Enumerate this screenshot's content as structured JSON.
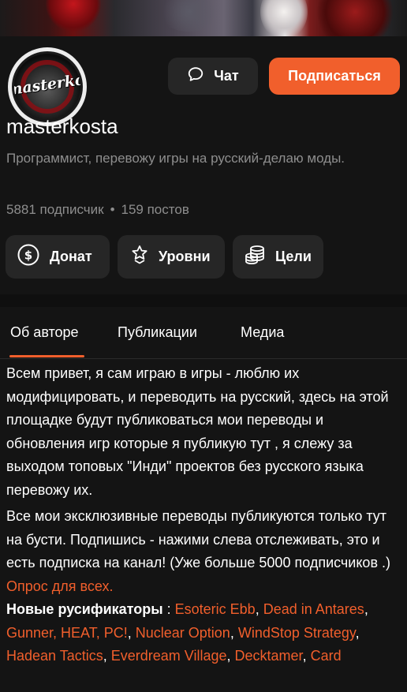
{
  "profile": {
    "avatar_logo_text": "masterkosta",
    "username": "masterkosta",
    "bio": "Программист, перевожу игры на русский-делаю моды.",
    "subscribers": "5881 подписчик",
    "separator": "•",
    "posts": "159 постов"
  },
  "header_buttons": {
    "chat_label": "Чат",
    "subscribe_label": "Подписаться"
  },
  "actions": {
    "donate_label": "Донат",
    "levels_label": "Уровни",
    "goals_label": "Цели"
  },
  "tabs": [
    {
      "label": "Об авторе",
      "active": true
    },
    {
      "label": "Публикации",
      "active": false
    },
    {
      "label": "Медиа",
      "active": false
    }
  ],
  "about": {
    "paragraph1": "Всем привет, я сам играю в игры - люблю их модифицировать, и переводить на русский, здесь на этой площадке будут публиковаться мои переводы и обновления игр которые я публикую тут , я слежу за выходом топовых \"Инди\" проектов без русского языка перевожу их.",
    "paragraph2": "Все мои эксклюзивные переводы публикуются только тут на бусти. Подпишись - нажими слева отслеживать, это и есть подписка на канал! (Уже больше 5000 подписчиков .)",
    "poll_link": "Опрос для всех.",
    "new_heading": "Новые русификаторы",
    "new_heading_colon": " : ",
    "links": [
      "Esoteric Ebb",
      "Dead in Antares",
      "Gunner, HEAT, PC!",
      "Nuclear Option",
      "WindStop Strategy",
      "Hadean Tactics",
      "Everdream Village",
      "Decktamer",
      "Card"
    ],
    "link_separator": ", "
  },
  "colors": {
    "accent": "#f15f2c",
    "background": "#0f0f0f",
    "panel": "#141414",
    "button": "#262626",
    "muted_text": "#8e8e8e"
  },
  "icons": {
    "chat": "chat-bubble-icon",
    "donate": "dollar-circle-icon",
    "levels": "star-levels-icon",
    "goals": "coins-stack-icon"
  }
}
